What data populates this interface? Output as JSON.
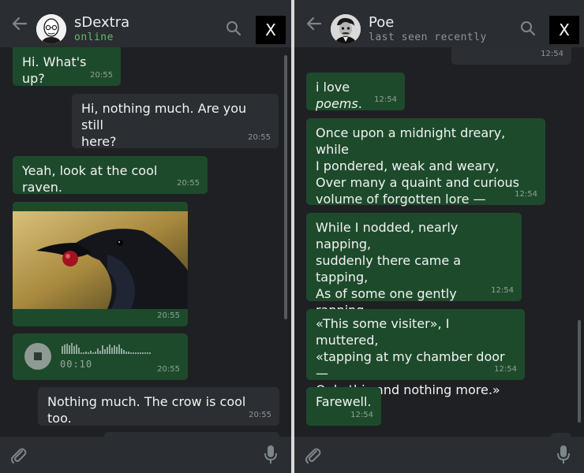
{
  "left_chat": {
    "contact_name": "sDextra",
    "contact_status": "online",
    "close_label": "X",
    "messages": [
      {
        "type": "text",
        "direction": "in",
        "text": "Hi. What's up?",
        "time": "20:55"
      },
      {
        "type": "text",
        "direction": "out",
        "text": "Hi, nothing much. Are you still\nhere?",
        "time": "20:55"
      },
      {
        "type": "text",
        "direction": "in",
        "text": "Yeah, look at the cool raven.",
        "time": "20:55"
      },
      {
        "type": "image",
        "direction": "in",
        "time": "20:55"
      },
      {
        "type": "voice",
        "direction": "in",
        "duration": "00:10",
        "time": "20:55"
      },
      {
        "type": "text",
        "direction": "out",
        "text": "Nothing much. The crow is cool too.",
        "time": "20:55"
      }
    ]
  },
  "right_chat": {
    "contact_name": "Poe",
    "contact_status": "last seen recently",
    "close_label": "X",
    "messages": [
      {
        "type": "text",
        "direction": "out",
        "text": "",
        "time": "12:54"
      },
      {
        "type": "text",
        "direction": "in",
        "text_before": "i love ",
        "text_em": "poems",
        "text_after": ".",
        "time": "12:54"
      },
      {
        "type": "text",
        "direction": "in",
        "text": "Once upon a midnight dreary, while\nI pondered, weak and weary,\nOver many a quaint and curious\nvolume of forgotten lore —",
        "time": "12:54"
      },
      {
        "type": "text",
        "direction": "in",
        "text": "While I nodded, nearly napping,\nsuddenly there came a tapping,\nAs of some one gently rapping,\nrapping at my chamber door —",
        "time": "12:54"
      },
      {
        "type": "text",
        "direction": "in",
        "text": "«This some visiter», I muttered,\n«tapping at my chamber door —\nOnly this and nothing more.»",
        "time": "12:54"
      },
      {
        "type": "text",
        "direction": "in",
        "text": "Farewell.",
        "time": "12:54"
      }
    ]
  },
  "colors": {
    "incoming_bubble": "#1e4a2c",
    "outgoing_bubble": "#2b2e32",
    "online_status": "#5fbe6b",
    "header": "#2a2d31",
    "background": "#1f2023"
  },
  "icons": [
    "back-arrow-icon",
    "search-icon",
    "close-icon",
    "paperclip-icon",
    "microphone-icon",
    "stop-icon"
  ]
}
